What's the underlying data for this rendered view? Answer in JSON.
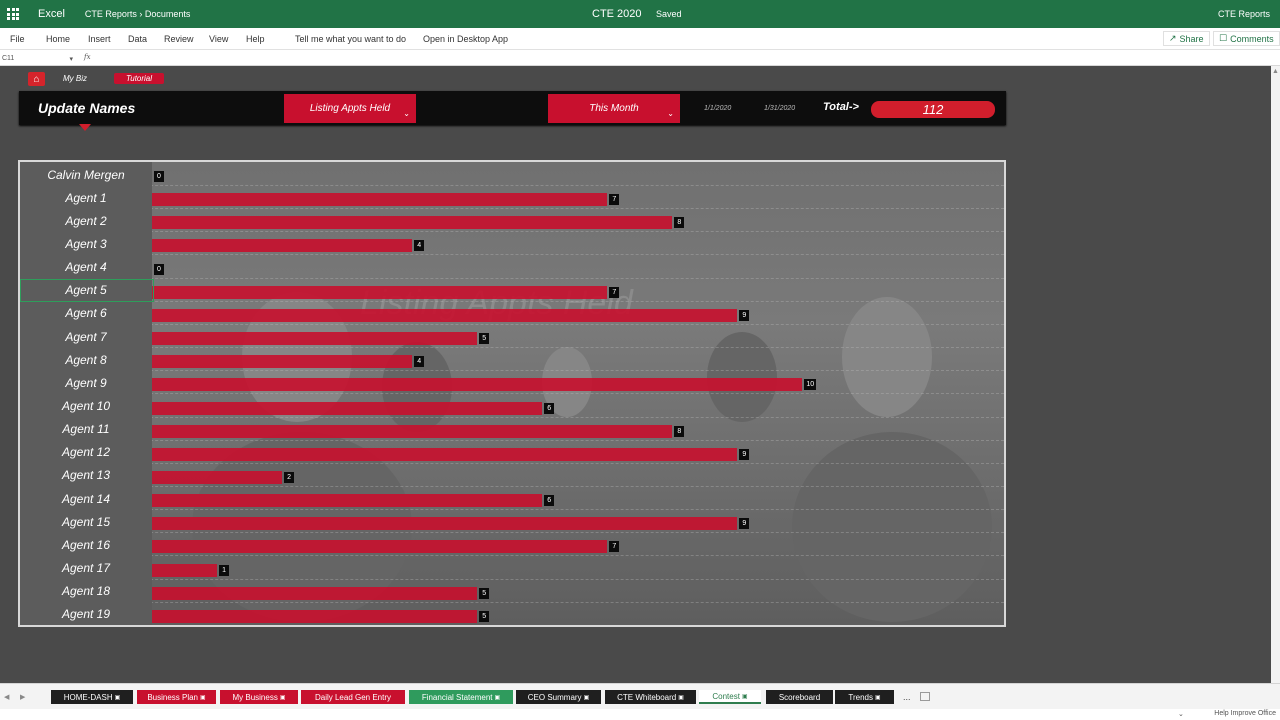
{
  "app": {
    "name": "Excel",
    "breadcrumb": "CTE Reports › Documents",
    "doc_title": "CTE 2020",
    "status": "Saved",
    "right_label": "CTE Reports",
    "brand_color": "#217346"
  },
  "menu": {
    "items": [
      "File",
      "Home",
      "Insert",
      "Data",
      "Review",
      "View",
      "Help"
    ],
    "tell_me": "Tell me what you want to do",
    "open_desktop": "Open in Desktop App",
    "share": "Share",
    "comments": "Comments"
  },
  "formula": {
    "cell_ref": "C11",
    "fx": "fx",
    "value": ""
  },
  "dashboard": {
    "nav": {
      "my_biz": "My Biz",
      "tutorial": "Tutorial"
    },
    "title": "Update Names",
    "metric": "Listing Appts Held",
    "period": "This Month",
    "start_date": "1/1/2020",
    "end_date": "1/31/2020",
    "total_label": "Total->",
    "total_value": "112",
    "watermark": "Listing Appts Held",
    "accent_color": "#c8102e"
  },
  "chart_data": {
    "type": "bar",
    "orientation": "horizontal",
    "categories": [
      "Calvin Mergen",
      "Agent 1",
      "Agent 2",
      "Agent 3",
      "Agent 4",
      "Agent 5",
      "Agent 6",
      "Agent 7",
      "Agent 8",
      "Agent 9",
      "Agent 10",
      "Agent 11",
      "Agent 12",
      "Agent 13",
      "Agent 14",
      "Agent 15",
      "Agent 16",
      "Agent 17",
      "Agent 18",
      "Agent 19"
    ],
    "values": [
      0,
      7,
      8,
      4,
      0,
      7,
      9,
      5,
      4,
      10,
      6,
      8,
      9,
      2,
      6,
      9,
      7,
      1,
      5,
      5
    ],
    "xlim": [
      0,
      13.1
    ],
    "grid": false,
    "legend": "none"
  },
  "selected_row": 5,
  "sheet_tabs": [
    {
      "label": "HOME-DASH",
      "style": "dark",
      "locked": true
    },
    {
      "label": "Business Plan",
      "style": "red",
      "locked": true
    },
    {
      "label": "My Business",
      "style": "red",
      "locked": true
    },
    {
      "label": "Daily Lead Gen Entry",
      "style": "red",
      "locked": false
    },
    {
      "label": "Financial Statement",
      "style": "green",
      "locked": true
    },
    {
      "label": "CEO Summary",
      "style": "dark",
      "locked": true
    },
    {
      "label": "CTE Whiteboard",
      "style": "dark",
      "locked": true
    },
    {
      "label": "Contest",
      "style": "active",
      "locked": true
    },
    {
      "label": "Scoreboard",
      "style": "dark",
      "locked": false
    },
    {
      "label": "Trends",
      "style": "dark",
      "locked": true
    }
  ],
  "tabbar": {
    "more": "..."
  },
  "statusbar": {
    "help": "Help Improve Office"
  }
}
